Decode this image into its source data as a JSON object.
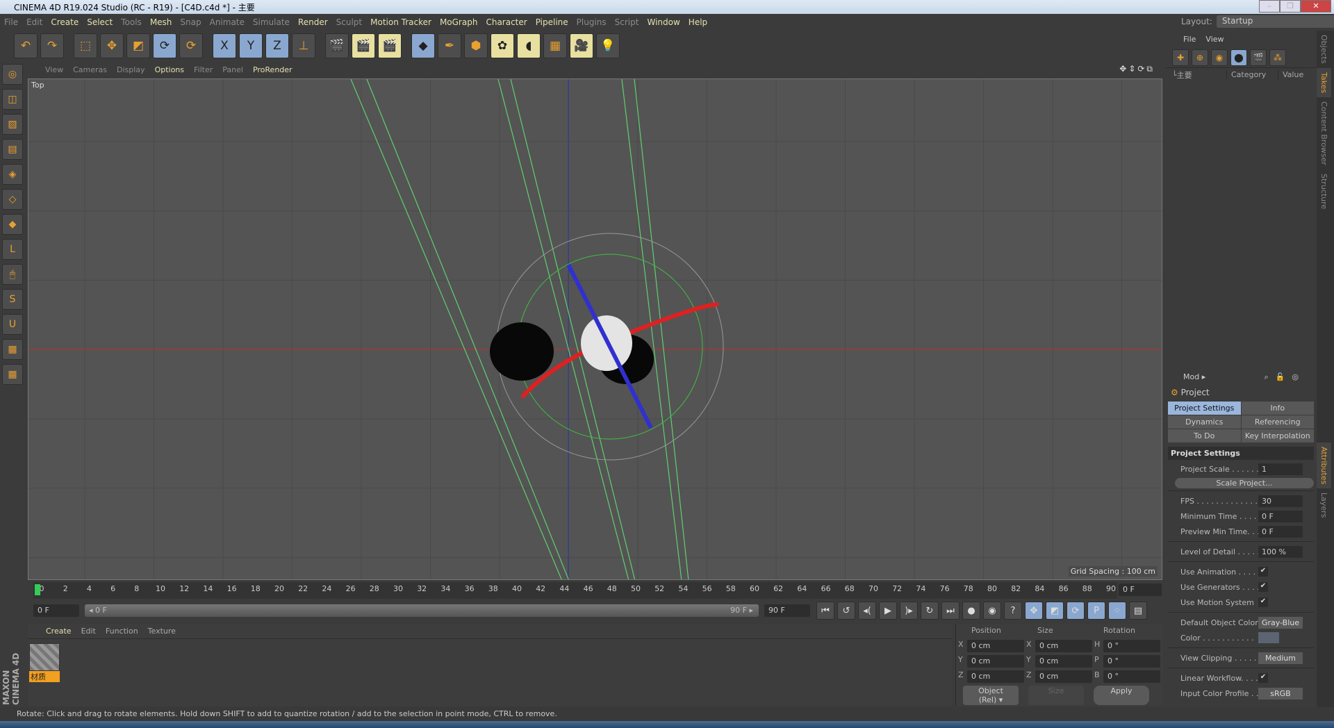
{
  "window": {
    "title": "CINEMA 4D R19.024 Studio (RC - R19) - [C4D.c4d *] - 主要",
    "controls": [
      "minimize",
      "restore",
      "close"
    ]
  },
  "menu": [
    {
      "label": "File",
      "enabled": false
    },
    {
      "label": "Edit",
      "enabled": false
    },
    {
      "label": "Create",
      "enabled": true
    },
    {
      "label": "Select",
      "enabled": true
    },
    {
      "label": "Tools",
      "enabled": false
    },
    {
      "label": "Mesh",
      "enabled": true
    },
    {
      "label": "Snap",
      "enabled": false
    },
    {
      "label": "Animate",
      "enabled": false
    },
    {
      "label": "Simulate",
      "enabled": false
    },
    {
      "label": "Render",
      "enabled": true
    },
    {
      "label": "Sculpt",
      "enabled": false
    },
    {
      "label": "Motion Tracker",
      "enabled": true
    },
    {
      "label": "MoGraph",
      "enabled": true
    },
    {
      "label": "Character",
      "enabled": true
    },
    {
      "label": "Pipeline",
      "enabled": true
    },
    {
      "label": "Plugins",
      "enabled": false
    },
    {
      "label": "Script",
      "enabled": false
    },
    {
      "label": "Window",
      "enabled": true
    },
    {
      "label": "Help",
      "enabled": true
    }
  ],
  "layout": {
    "label": "Layout:",
    "value": "Startup"
  },
  "toolbar": [
    "undo",
    "redo",
    "live-selection",
    "move",
    "scale",
    "rotate",
    "recent-tool",
    "x-axis",
    "y-axis",
    "z-axis",
    "coordinate-system",
    "render-view",
    "render-picture-viewer",
    "edit-render-settings",
    "cube",
    "pen",
    "subdivision",
    "cloner",
    "deformer",
    "floor",
    "camera",
    "light"
  ],
  "toolbar_glyphs": [
    "↶",
    "↷",
    "⬚",
    "✥",
    "◩",
    "⟳",
    "⟳",
    "X",
    "Y",
    "Z",
    "⊥",
    "🎬",
    "🎬",
    "🎬",
    "◆",
    "✒",
    "⬢",
    "✿",
    "◖",
    "▦",
    "🎥",
    "💡"
  ],
  "left_tools": [
    "make-editable",
    "model",
    "texture",
    "workplane",
    "points",
    "edges",
    "polygons",
    "axis",
    "tweak",
    "solo",
    "snap",
    "lock-workplane",
    "planar-workplane"
  ],
  "left_glyphs": [
    "◎",
    "◫",
    "▨",
    "▤",
    "◈",
    "◇",
    "◆",
    "L",
    "🖱",
    "S",
    "U",
    "▦",
    "▦"
  ],
  "viewport": {
    "menu": [
      {
        "label": "View",
        "active": false
      },
      {
        "label": "Cameras",
        "active": false
      },
      {
        "label": "Display",
        "active": false
      },
      {
        "label": "Options",
        "active": true
      },
      {
        "label": "Filter",
        "active": false
      },
      {
        "label": "Panel",
        "active": false
      },
      {
        "label": "ProRender",
        "active": true
      }
    ],
    "name": "Top",
    "grid_spacing": "Grid Spacing : 100 cm",
    "nav_icons": "✥⇕⟳⧉"
  },
  "timeline": {
    "ticks": [
      "0",
      "2",
      "4",
      "6",
      "8",
      "10",
      "12",
      "14",
      "16",
      "18",
      "20",
      "22",
      "24",
      "26",
      "28",
      "30",
      "32",
      "34",
      "36",
      "38",
      "40",
      "42",
      "44",
      "46",
      "48",
      "50",
      "52",
      "54",
      "56",
      "58",
      "60",
      "62",
      "64",
      "66",
      "68",
      "70",
      "72",
      "74",
      "76",
      "78",
      "80",
      "82",
      "84",
      "86",
      "88",
      "90"
    ],
    "current": "0 F",
    "start": "0 F",
    "slider_start": "◂ 0 F",
    "slider_end": "90 F ▸",
    "end": "90 F"
  },
  "playback": [
    "⏮",
    "↺",
    "◂(",
    "▶",
    ")▸",
    "↻",
    "⏭",
    "●",
    "◉",
    "?",
    "✥",
    "◩",
    "⟳",
    "P",
    "⁘",
    "▤"
  ],
  "materials": {
    "menu": [
      "Create",
      "Edit",
      "Function",
      "Texture"
    ],
    "item": "材质"
  },
  "brand": "MAXON CINEMA 4D",
  "coords": {
    "headers": [
      "Position",
      "Size",
      "Rotation"
    ],
    "rows": [
      {
        "pa": "X",
        "p": "0 cm",
        "sa": "X",
        "s": "0 cm",
        "ra": "H",
        "r": "0 °"
      },
      {
        "pa": "Y",
        "p": "0 cm",
        "sa": "Y",
        "s": "0 cm",
        "ra": "P",
        "r": "0 °"
      },
      {
        "pa": "Z",
        "p": "0 cm",
        "sa": "Z",
        "s": "0 cm",
        "ra": "B",
        "r": "0 °"
      }
    ],
    "mode": "Object (Rel) ▾",
    "size_mode": "Size",
    "apply": "Apply"
  },
  "status": "Rotate: Click and drag to rotate elements. Hold down SHIFT to add to quantize rotation / add to the selection in point mode, CTRL to remove.",
  "objects": {
    "menu": [
      "File",
      "View"
    ],
    "tree_root": "└主要",
    "columns": [
      "Category",
      "Value"
    ]
  },
  "attributes": {
    "mode": "Mod ▸",
    "title": "Project",
    "tabs": [
      {
        "label": "Project Settings",
        "active": true
      },
      {
        "label": "Info",
        "active": false
      },
      {
        "label": "Dynamics",
        "active": false
      },
      {
        "label": "Referencing",
        "active": false
      },
      {
        "label": "To Do",
        "active": false
      },
      {
        "label": "Key Interpolation",
        "active": false
      }
    ],
    "section": "Project Settings",
    "project_scale": {
      "label": "Project Scale . . . . . . .",
      "value": "1"
    },
    "scale_button": "Scale Project...",
    "fps": {
      "label": "FPS . . . . . . . . . . . . . . .",
      "value": "30"
    },
    "min_time": {
      "label": "Minimum Time . . . . .",
      "value": "0 F"
    },
    "preview_min": {
      "label": "Preview Min Time. . .",
      "value": "0 F"
    },
    "lod": {
      "label": "Level of Detail . . . . . .",
      "value": "100 %"
    },
    "use_animation": {
      "label": "Use Animation . . . . .",
      "checked": true
    },
    "use_generators": {
      "label": "Use Generators . . . . .",
      "checked": true
    },
    "use_motion": {
      "label": "Use Motion System",
      "checked": true
    },
    "default_color": {
      "label": "Default Object Color",
      "value": "Gray-Blue"
    },
    "color": {
      "label": "Color . . . . . . . . . . .",
      "swatch": "#5b6470"
    },
    "view_clipping": {
      "label": "View Clipping . . . . . .",
      "value": "Medium"
    },
    "linear_workflow": {
      "label": "Linear Workflow. . . .",
      "checked": true
    },
    "input_profile": {
      "label": "Input Color Profile . .",
      "value": "sRGB"
    },
    "check": "✔"
  },
  "side_tabs": [
    {
      "label": "Objects",
      "active": false
    },
    {
      "label": "Takes",
      "active": true
    },
    {
      "label": "Content Browser",
      "active": false
    },
    {
      "label": "Structure",
      "active": false
    },
    {
      "label": "Attributes",
      "active": true
    },
    {
      "label": "Layers",
      "active": false
    }
  ],
  "colors": {
    "accent": "#e8a030",
    "active_tab": "#9ab6dc",
    "x_axis": "#d02020",
    "y_axis": "#2030c0",
    "spline": "#50d060"
  }
}
